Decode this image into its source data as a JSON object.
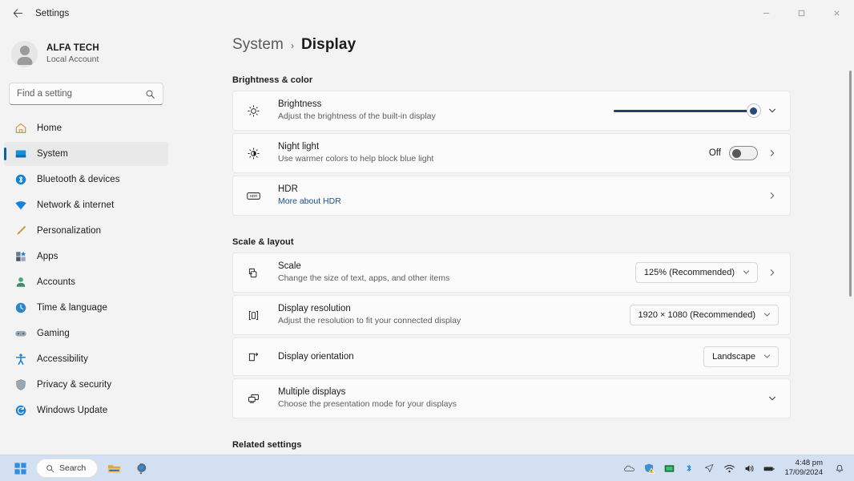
{
  "window": {
    "title": "Settings",
    "back_icon": "back-arrow-icon",
    "minimize": "–",
    "maximize": "□",
    "close": "✕"
  },
  "sidebar": {
    "profile": {
      "name": "ALFA TECH",
      "subtitle": "Local Account"
    },
    "search": {
      "placeholder": "Find a setting",
      "value": "",
      "icon": "search-icon"
    },
    "items": [
      {
        "label": "Home",
        "icon": "home-icon",
        "active": false
      },
      {
        "label": "System",
        "icon": "system-icon",
        "active": true
      },
      {
        "label": "Bluetooth & devices",
        "icon": "bluetooth-icon",
        "active": false
      },
      {
        "label": "Network & internet",
        "icon": "network-icon",
        "active": false
      },
      {
        "label": "Personalization",
        "icon": "personalization-icon",
        "active": false
      },
      {
        "label": "Apps",
        "icon": "apps-icon",
        "active": false
      },
      {
        "label": "Accounts",
        "icon": "accounts-icon",
        "active": false
      },
      {
        "label": "Time & language",
        "icon": "time-icon",
        "active": false
      },
      {
        "label": "Gaming",
        "icon": "gaming-icon",
        "active": false
      },
      {
        "label": "Accessibility",
        "icon": "accessibility-icon",
        "active": false
      },
      {
        "label": "Privacy & security",
        "icon": "shield-icon",
        "active": false
      },
      {
        "label": "Windows Update",
        "icon": "update-icon",
        "active": false
      }
    ]
  },
  "main": {
    "breadcrumb": {
      "parent": "System",
      "separator": "›",
      "current": "Display"
    },
    "sections": {
      "brightness_color": "Brightness & color",
      "scale_layout": "Scale & layout",
      "related_settings": "Related settings"
    },
    "brightness": {
      "title": "Brightness",
      "subtitle": "Adjust the brightness of the built-in display",
      "icon": "brightness-sun-icon",
      "value": 97,
      "expand_icon": "chevron-down-icon"
    },
    "night_light": {
      "title": "Night light",
      "subtitle": "Use warmer colors to help block blue light",
      "icon": "night-light-icon",
      "state_label": "Off",
      "toggle_on": false,
      "chevron": "chevron-right-icon"
    },
    "hdr": {
      "title": "HDR",
      "subtitle": "More about HDR",
      "icon": "hdr-badge-icon",
      "chevron": "chevron-right-icon"
    },
    "scale": {
      "title": "Scale",
      "subtitle": "Change the size of text, apps, and other items",
      "icon": "scale-icon",
      "value": "125% (Recommended)",
      "dropdown_icon": "chevron-down-icon",
      "chevron": "chevron-right-icon"
    },
    "resolution": {
      "title": "Display resolution",
      "subtitle": "Adjust the resolution to fit your connected display",
      "icon": "resolution-icon",
      "value": "1920 × 1080 (Recommended)",
      "dropdown_icon": "chevron-down-icon"
    },
    "orientation": {
      "title": "Display orientation",
      "subtitle": "",
      "icon": "orientation-icon",
      "value": "Landscape",
      "dropdown_icon": "chevron-down-icon"
    },
    "multiple_displays": {
      "title": "Multiple displays",
      "subtitle": "Choose the presentation mode for your displays",
      "icon": "multiple-displays-icon",
      "expand_icon": "chevron-down-icon"
    }
  },
  "taskbar": {
    "start_icon": "windows-start-icon",
    "search": {
      "label": "Search",
      "icon": "search-icon"
    },
    "apps": [
      {
        "name": "file-explorer-icon"
      },
      {
        "name": "settings-gear-icon"
      }
    ],
    "tray": [
      {
        "name": "onedrive-cloud-icon"
      },
      {
        "name": "security-warning-icon"
      },
      {
        "name": "display-adapter-icon"
      },
      {
        "name": "bluetooth-icon"
      },
      {
        "name": "location-icon"
      },
      {
        "name": "wifi-icon"
      },
      {
        "name": "volume-icon"
      },
      {
        "name": "battery-icon"
      }
    ],
    "clock": {
      "time": "4:48 pm",
      "date": "17/09/2024"
    },
    "notification_icon": "bell-icon"
  },
  "colors": {
    "accent": "#0b5fa5",
    "slider_fill": "#2b3f63",
    "link": "#1c4e8f",
    "page_bg": "#f3f3f3",
    "card_bg": "#fbfbfb",
    "taskbar_bg": "#d3e0f2"
  }
}
